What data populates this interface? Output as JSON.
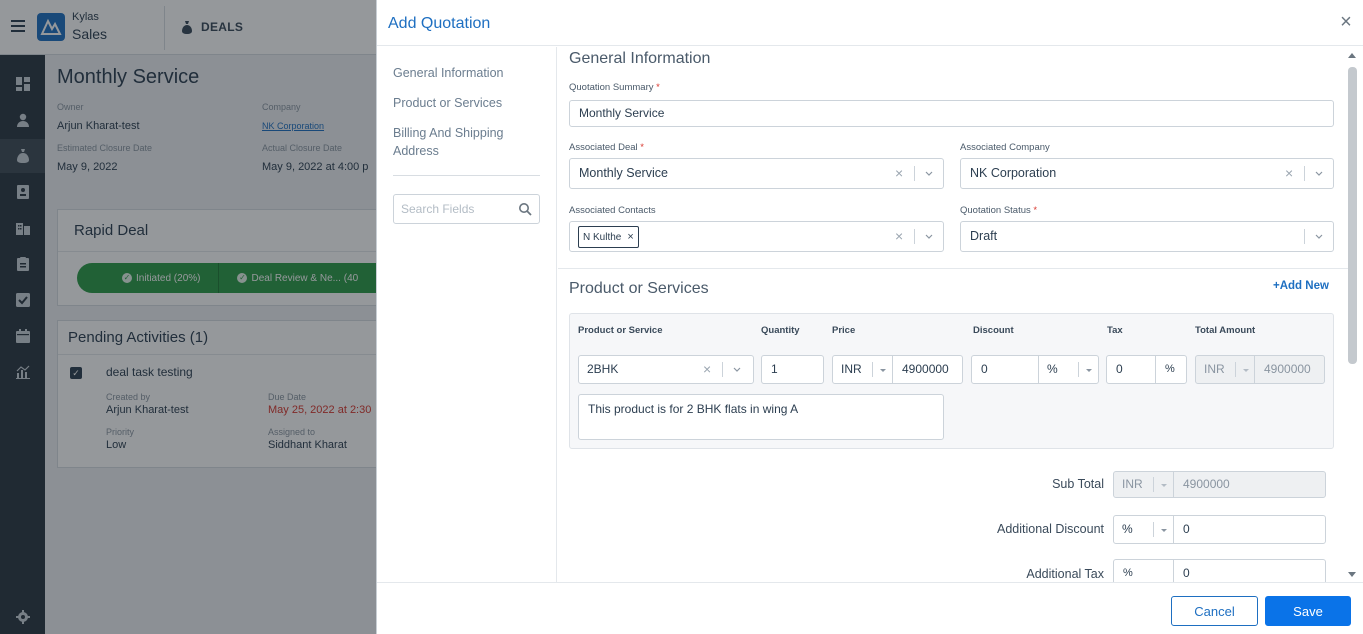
{
  "app": {
    "brand_line1": "Kylas",
    "brand_line2": "Sales",
    "module": "DEALS"
  },
  "rail_icons": [
    "dashboard-icon",
    "contact-icon",
    "deal-icon",
    "lead-icon",
    "company-icon",
    "clipboard-icon",
    "task-icon",
    "calendar-icon",
    "report-icon",
    "settings-icon"
  ],
  "background_page": {
    "title": "Monthly Service",
    "owner_label": "Owner",
    "owner": "Arjun Kharat-test",
    "company_label": "Company",
    "company": "NK Corporation",
    "est_close_label": "Estimated Closure Date",
    "est_close": "May 9, 2022",
    "actual_close_label": "Actual Closure Date",
    "actual_close": "May 9, 2022 at 4:00 p",
    "pipeline_title": "Rapid Deal",
    "stages": [
      "Initiated (20%)",
      "Deal Review & Ne... (40"
    ],
    "activities_title": "Pending Activities (1)",
    "activity": {
      "title": "deal task testing",
      "created_by_label": "Created by",
      "created_by": "Arjun Kharat-test",
      "due_label": "Due Date",
      "due": "May 25, 2022 at 2:30",
      "priority_label": "Priority",
      "priority": "Low",
      "assigned_label": "Assigned to",
      "assigned": "Siddhant Kharat"
    }
  },
  "modal": {
    "title": "Add Quotation",
    "nav": [
      "General Information",
      "Product or Services",
      "Billing And Shipping Address"
    ],
    "search_placeholder": "Search Fields",
    "general": {
      "heading": "General Information",
      "summary_label": "Quotation Summary",
      "summary_value": "Monthly Service",
      "deal_label": "Associated Deal",
      "deal_value": "Monthly Service",
      "company_label": "Associated Company",
      "company_value": "NK Corporation",
      "contacts_label": "Associated Contacts",
      "contact_tag": "N Kulthe",
      "status_label": "Quotation Status",
      "status_value": "Draft"
    },
    "products": {
      "heading": "Product or Services",
      "add_new": "Add New",
      "columns": [
        "Product or Service",
        "Quantity",
        "Price",
        "Discount",
        "Tax",
        "Total Amount"
      ],
      "row": {
        "product": "2BHK",
        "quantity": "1",
        "price_currency": "INR",
        "price": "4900000",
        "discount": "0",
        "discount_type": "%",
        "tax": "0",
        "tax_unit": "%",
        "total_currency": "INR",
        "total": "4900000",
        "description": "This product is for 2 BHK flats in wing A"
      }
    },
    "totals": {
      "subtotal_label": "Sub Total",
      "subtotal_currency": "INR",
      "subtotal": "4900000",
      "add_discount_label": "Additional Discount",
      "add_discount_type": "%",
      "add_discount": "0",
      "add_tax_label": "Additional Tax",
      "add_tax_unit": "%",
      "add_tax": "0"
    },
    "buttons": {
      "cancel": "Cancel",
      "save": "Save"
    }
  },
  "colors": {
    "accent": "#1e6fc1",
    "primary_button": "#0a73e8",
    "stage_green": "#2d9b47",
    "rail": "#2b3742",
    "required": "#d9382f"
  }
}
